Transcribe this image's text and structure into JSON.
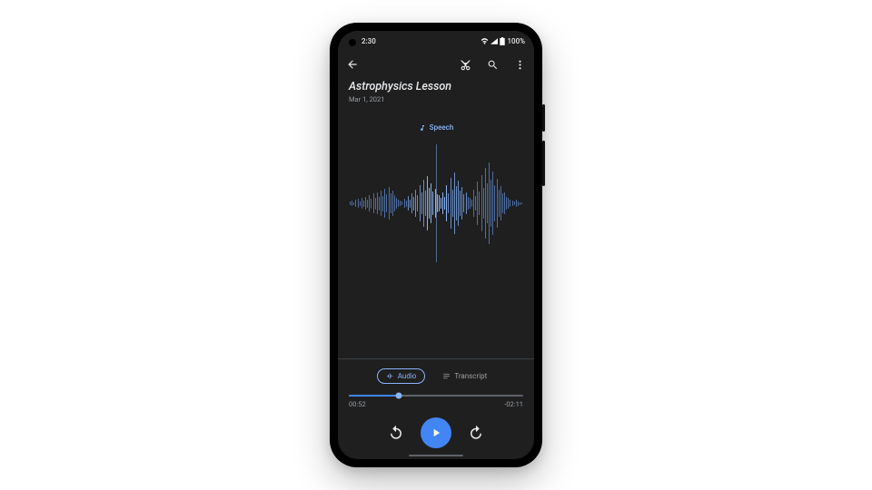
{
  "status": {
    "time": "2:30",
    "battery": "100%"
  },
  "recording": {
    "title": "Astrophysics Lesson",
    "date": "Mar 1, 2021"
  },
  "detect_label": "Speech",
  "tabs": {
    "audio": "Audio",
    "transcript": "Transcript"
  },
  "playback": {
    "elapsed": "00:52",
    "remaining": "-02:11",
    "progress_pct": 28.4
  },
  "waveform_bars": [
    4,
    6,
    3,
    8,
    10,
    5,
    12,
    7,
    14,
    9,
    18,
    11,
    22,
    13,
    24,
    15,
    28,
    17,
    32,
    20,
    36,
    22,
    28,
    18,
    12,
    8,
    6,
    4,
    10,
    7,
    16,
    9,
    22,
    15,
    30,
    18,
    40,
    24,
    52,
    28,
    60,
    34,
    44,
    26,
    32,
    20,
    18,
    12,
    24,
    14,
    40,
    22,
    56,
    30,
    68,
    38,
    50,
    28,
    36,
    20,
    24,
    14,
    12,
    8,
    30,
    16,
    48,
    26,
    62,
    34,
    78,
    44,
    90,
    52,
    70,
    40,
    54,
    30,
    38,
    22,
    24,
    14,
    12,
    8,
    6,
    4,
    8,
    5,
    3,
    2
  ],
  "colors": {
    "accent": "#8ab4f8",
    "primary": "#4285f4",
    "bg": "#1f1f1f"
  }
}
